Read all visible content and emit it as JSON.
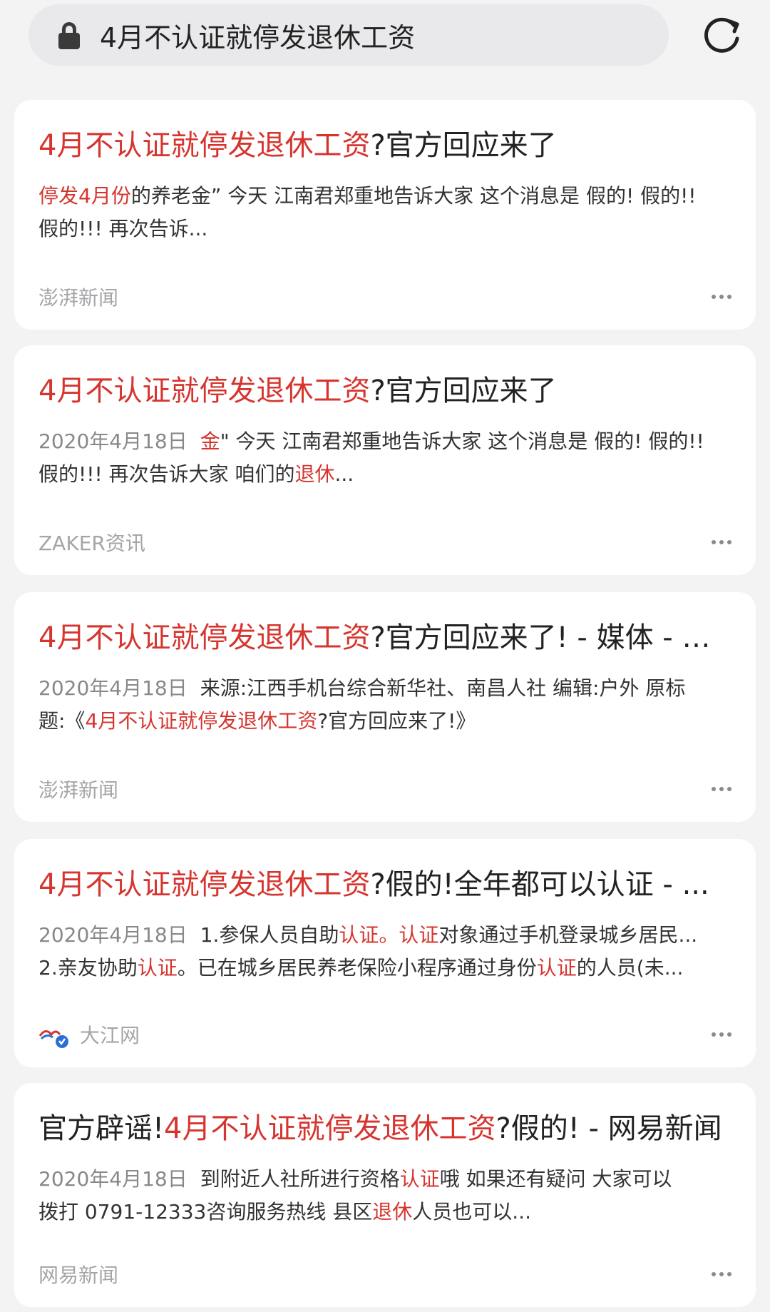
{
  "search": {
    "query": "4月不认证就停发退休工资"
  },
  "results": [
    {
      "title_parts": [
        {
          "t": "4月不认证就停发退休工资",
          "hl": true
        },
        {
          "t": "?官方回应来了",
          "hl": false
        }
      ],
      "date": "",
      "lines": [
        [
          {
            "t": "停发4月份",
            "hl": true
          },
          {
            "t": "的养老金” 今天 江南君郑重地告诉大家 这个消息是 假的! 假的!!",
            "hl": false
          }
        ],
        [
          {
            "t": "假的!!! 再次告诉...",
            "hl": false
          }
        ]
      ],
      "source": "澎湃新闻"
    },
    {
      "title_parts": [
        {
          "t": "4月不认证就停发退休工资",
          "hl": true
        },
        {
          "t": "?官方回应来了",
          "hl": false
        }
      ],
      "date": "2020年4月18日",
      "lines": [
        [
          {
            "t": "金",
            "hl": true
          },
          {
            "t": "\" 今天 江南君郑重地告诉大家 这个消息是 假的! 假的!!",
            "hl": false
          }
        ],
        [
          {
            "t": "假的!!! 再次告诉大家 咱们的",
            "hl": false
          },
          {
            "t": "退休",
            "hl": true
          },
          {
            "t": "...",
            "hl": false
          }
        ]
      ],
      "source": "ZAKER资讯"
    },
    {
      "title_parts": [
        {
          "t": "4月不认证就停发退休工资",
          "hl": true
        },
        {
          "t": "?官方回应来了! - 媒体 - 澎...",
          "hl": false
        }
      ],
      "date": "2020年4月18日",
      "lines": [
        [
          {
            "t": "来源:江西手机台综合新华社、南昌人社 编辑:户外 原标",
            "hl": false
          }
        ],
        [
          {
            "t": "题:《",
            "hl": false
          },
          {
            "t": "4月不认证就停发退休工资",
            "hl": true
          },
          {
            "t": "?官方回应来了!》",
            "hl": false
          }
        ]
      ],
      "source": "澎湃新闻"
    },
    {
      "title_parts": [
        {
          "t": "4月不认证就停发退休工资",
          "hl": true
        },
        {
          "t": "?假的!全年都可以认证 - ...",
          "hl": false
        }
      ],
      "date": "2020年4月18日",
      "lines": [
        [
          {
            "t": "1.参保人员自助",
            "hl": false
          },
          {
            "t": "认证。认证",
            "hl": true
          },
          {
            "t": "对象通过手机登录城乡居民...",
            "hl": false
          }
        ],
        [
          {
            "t": "2.亲友协助",
            "hl": false
          },
          {
            "t": "认证",
            "hl": true
          },
          {
            "t": "。已在城乡居民养老保险小程序通过身份",
            "hl": false
          },
          {
            "t": "认证",
            "hl": true
          },
          {
            "t": "的人员(未...",
            "hl": false
          }
        ]
      ],
      "source": "大江网",
      "source_logo": "dajiang-logo-icon"
    },
    {
      "title_parts": [
        {
          "t": "官方辟谣!",
          "hl": false
        },
        {
          "t": "4月不认证就停发退休工资",
          "hl": true
        },
        {
          "t": "?假的! - 网易新闻",
          "hl": false
        }
      ],
      "date": "2020年4月18日",
      "lines": [
        [
          {
            "t": "到附近人社所进行资格",
            "hl": false
          },
          {
            "t": "认证",
            "hl": true
          },
          {
            "t": "哦 如果还有疑问 大家可以",
            "hl": false
          }
        ],
        [
          {
            "t": "拨打 0791-12333咨询服务热线 县区",
            "hl": false
          },
          {
            "t": "退休",
            "hl": true
          },
          {
            "t": "人员也可以...",
            "hl": false
          }
        ]
      ],
      "source": "网易新闻"
    }
  ],
  "colors": {
    "highlight": "#d6352f",
    "card": "#ffffff",
    "background": "#f3f3f4"
  }
}
